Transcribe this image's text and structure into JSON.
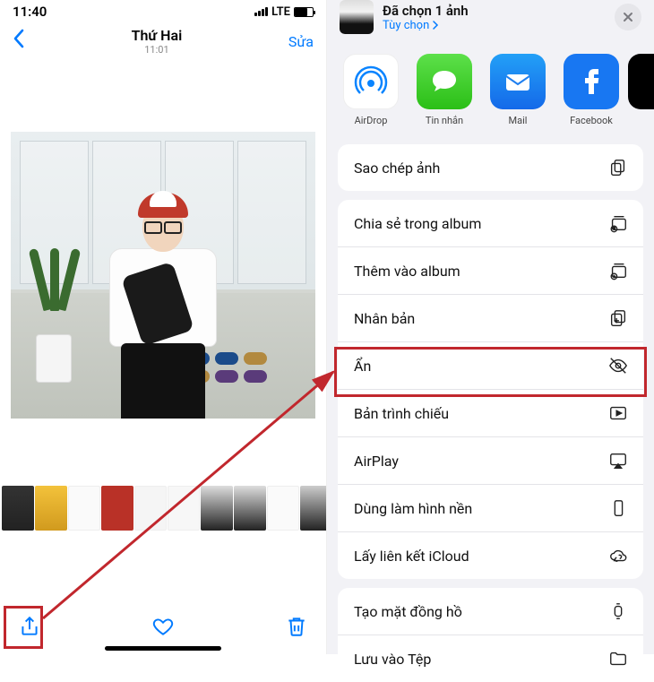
{
  "left": {
    "status": {
      "time": "11:40",
      "net": "LTE"
    },
    "nav": {
      "title": "Thứ Hai",
      "subtitle": "11:01",
      "edit": "Sửa"
    }
  },
  "right": {
    "header": {
      "title": "Đã chọn 1 ảnh",
      "options": "Tùy chọn"
    },
    "apps": {
      "airdrop": "AirDrop",
      "messages": "Tin nhắn",
      "mail": "Mail",
      "facebook": "Facebook"
    },
    "group1": {
      "copy": "Sao chép ảnh"
    },
    "group2": {
      "share_album": "Chia sẻ trong album",
      "add_album": "Thêm vào album",
      "duplicate": "Nhân bản",
      "hide": "Ẩn",
      "slideshow": "Bản trình chiếu",
      "airplay": "AirPlay",
      "wallpaper": "Dùng làm hình nền",
      "icloud_link": "Lấy liên kết iCloud"
    },
    "group3": {
      "watch_face": "Tạo mặt đồng hồ",
      "save_files": "Lưu vào Tệp"
    }
  }
}
